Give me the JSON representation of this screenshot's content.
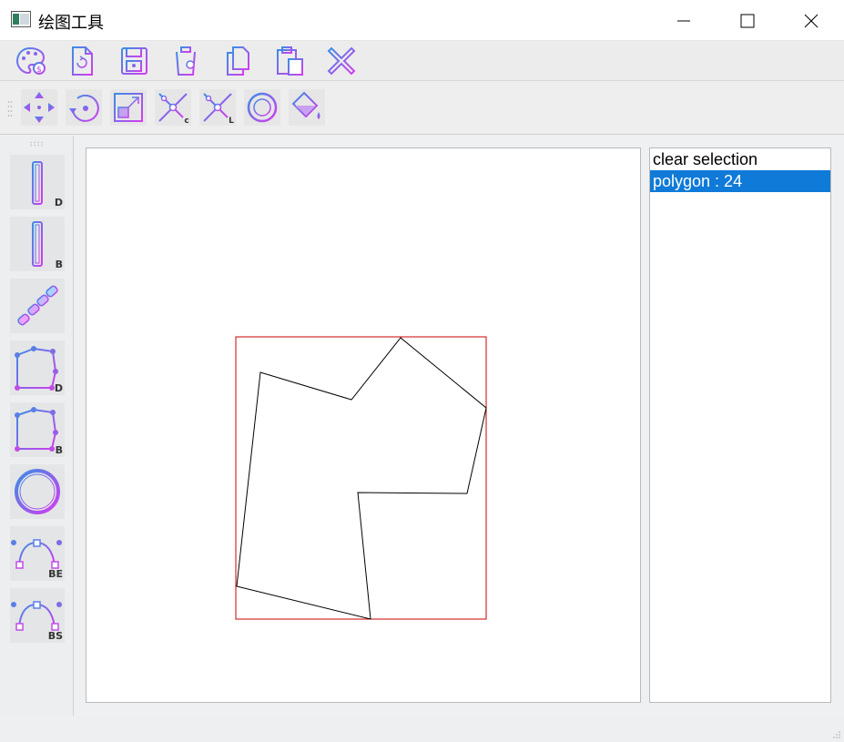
{
  "window": {
    "title": "绘图工具",
    "controls": [
      "minimize",
      "maximize",
      "close"
    ]
  },
  "toolbar_top": {
    "buttons": [
      {
        "name": "palette-icon"
      },
      {
        "name": "reload-file-icon"
      },
      {
        "name": "save-icon"
      },
      {
        "name": "trash-icon"
      },
      {
        "name": "copy-icon"
      },
      {
        "name": "paste-icon"
      },
      {
        "name": "delete-x-icon"
      }
    ]
  },
  "toolbar_tools": {
    "buttons": [
      {
        "name": "move-icon"
      },
      {
        "name": "rotate-icon"
      },
      {
        "name": "scale-icon"
      },
      {
        "name": "cut-c-icon",
        "label": "c"
      },
      {
        "name": "cut-l-icon",
        "label": "L"
      },
      {
        "name": "circle-target-icon"
      },
      {
        "name": "fill-bucket-icon"
      }
    ]
  },
  "sidebar": {
    "tools": [
      {
        "name": "rect-d-icon",
        "label": "D"
      },
      {
        "name": "rect-b-icon",
        "label": "B"
      },
      {
        "name": "chain-icon",
        "label": ""
      },
      {
        "name": "polygon-d-icon",
        "label": "D"
      },
      {
        "name": "polygon-b-icon",
        "label": "B"
      },
      {
        "name": "ring-icon",
        "label": ""
      },
      {
        "name": "bezier-be-icon",
        "label": "BE"
      },
      {
        "name": "bezier-bs-icon",
        "label": "BS"
      }
    ]
  },
  "shape_list": {
    "items": [
      {
        "label": "clear selection",
        "selected": false
      },
      {
        "label": "polygon : 24",
        "selected": true
      }
    ]
  },
  "colors": {
    "accent_gradient_start": "#3a8ee6",
    "accent_gradient_end": "#d43cf0",
    "selection_box": "#cc0000",
    "list_selection": "#0f7ad8"
  }
}
